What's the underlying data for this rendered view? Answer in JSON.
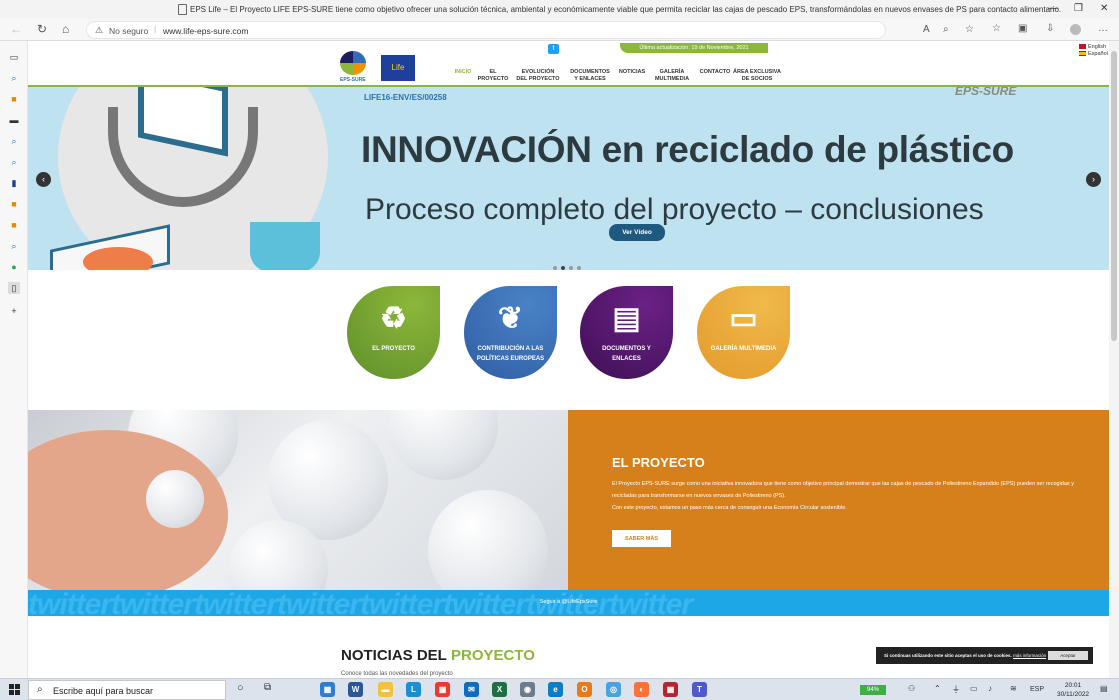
{
  "browser": {
    "window_title": "EPS Life – El Proyecto LIFE EPS-SURE tiene como objetivo ofrecer una solución técnica, ambiental y económicamente viable que permita reciclar las cajas de pescado EPS, transformándolas en nuevos envases de PS para contacto alimentario.",
    "security_label": "No seguro",
    "url": "www.life-eps-sure.com"
  },
  "site": {
    "logo_text": "EPS-SURE",
    "eu_label": "Life",
    "last_update": "Última actualización: 19 de Noviembre, 2021",
    "languages": [
      "English",
      "Español"
    ],
    "menu": [
      {
        "label": "INICIO",
        "active": true
      },
      {
        "label": "EL PROYECTO",
        "active": false
      },
      {
        "label": "EVOLUCIÓN DEL PROYECTO",
        "active": false
      },
      {
        "label": "DOCUMENTOS Y ENLACES",
        "active": false
      },
      {
        "label": "NOTICIAS",
        "active": false
      },
      {
        "label": "GALERÍA MULTIMEDIA",
        "active": false
      },
      {
        "label": "CONTACTO",
        "active": false
      },
      {
        "label": "ÁREA EXCLUSIVA DE SOCIOS",
        "active": false
      }
    ]
  },
  "hero": {
    "project_code": "LIFE16-ENV/ES/00258",
    "brand": "EPS-SURE",
    "title": "INNOVACIÓN en reciclado de plástico",
    "subtitle": "Proceso completo del proyecto – conclusiones",
    "video_button": "Ver Vídeo",
    "slide_count": 4,
    "active_slide": 2
  },
  "tiles": [
    {
      "label": "EL PROYECTO",
      "icon": "recycle-icon",
      "color": "#76a535"
    },
    {
      "label": "CONTRIBUCIÓN A LAS POLÍTICAS EUROPEAS",
      "icon": "plant-hand-icon",
      "color": "#3a6db3"
    },
    {
      "label": "DOCUMENTOS Y ENLACES",
      "icon": "document-icon",
      "color": "#4a1462"
    },
    {
      "label": "GALERÍA MULTIMEDIA",
      "icon": "devices-icon",
      "color": "#e9a83a"
    }
  ],
  "about": {
    "title": "EL PROYECTO",
    "paragraph1": "El Proyecto EPS-SURE surge como una iniciativa innovadora que tiene como objetivo principal demostrar que las cajas de pescado de Poliestireno Expandido (EPS) pueden ser recogidas y recicladas para transformarse en nuevos envases de Poliestireno (PS).",
    "paragraph2": "Con este proyecto, estamos un paso más cerca de conseguir una Economía Circular sostenible.",
    "more_button": "SABER MÁS"
  },
  "twitter": {
    "watermark": "twittertwittertwittertwittertwittertwittertwittertwitter",
    "follow_text": "Seguir a @LifeEpsSure"
  },
  "news": {
    "title_part1": "NOTICIAS DEL",
    "title_part2": "PROYECTO",
    "description": "Conoce todas las novedades del proyecto"
  },
  "cookie": {
    "text": "Si continuas utilizando este sitio aceptas el uso de cookies.",
    "link": "más información",
    "accept": "Aceptar"
  },
  "taskbar": {
    "search_placeholder": "Escribe aquí para buscar",
    "battery": "94%",
    "language": "ESP",
    "time": "20:01",
    "date": "30/11/2022"
  }
}
